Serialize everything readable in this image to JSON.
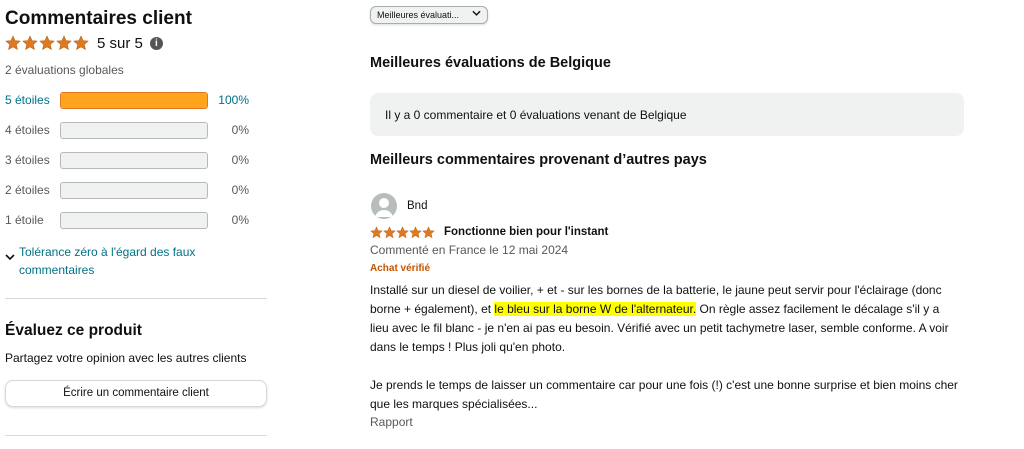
{
  "summary": {
    "title": "Commentaires client",
    "rating_value": 5,
    "rating_text": "5 sur 5",
    "global_count": "2 évaluations globales"
  },
  "histogram": [
    {
      "label": "5 étoiles",
      "percent": 100,
      "pct_text": "100%"
    },
    {
      "label": "4 étoiles",
      "percent": 0,
      "pct_text": "0%"
    },
    {
      "label": "3 étoiles",
      "percent": 0,
      "pct_text": "0%"
    },
    {
      "label": "2 étoiles",
      "percent": 0,
      "pct_text": "0%"
    },
    {
      "label": "1 étoile",
      "percent": 0,
      "pct_text": "0%"
    }
  ],
  "tolerance_link": "Tolérance zéro à l'égard des faux commentaires",
  "evaluate": {
    "title": "Évaluez ce produit",
    "subtitle": "Partagez votre opinion avec les autres clients",
    "button_label": "Écrire un commentaire client"
  },
  "sort": {
    "selected": "Meilleures évaluati..."
  },
  "belgium": {
    "heading": "Meilleures évaluations de Belgique",
    "message": "Il y a 0 commentaire et 0 évaluations venant de Belgique"
  },
  "other_countries_heading": "Meilleurs commentaires provenant d’autres pays",
  "review": {
    "reviewer": "Bnd",
    "rating": 5,
    "title": "Fonctionne bien pour l'instant",
    "date": "Commenté en France le 12 mai 2024",
    "verified": "Achat vérifié",
    "body_part1": "Installé sur un diesel de voilier, + et - sur les bornes de la batterie, le jaune peut servir pour l'éclairage (donc borne + également), et ",
    "body_highlight": "le bleu sur la borne W de l'alternateur.",
    "body_part2": " On règle assez facilement le décalage s'il y a lieu avec le fil blanc - je n'en ai pas eu besoin. Vérifié avec un petit tachymetre laser, semble conforme. A voir dans le temps ! Plus joli qu'en photo.",
    "body_para2": "Je prends le temps de laisser un commentaire car pour une fois (!) c'est une bonne surprise et bien moins cher que les marques spécialisées...",
    "report_label": "Rapport"
  },
  "colors": {
    "star": "#de7921",
    "bar_fill": "#ffa41c",
    "link": "#007185",
    "verified": "#c45500",
    "highlight": "#ffff00"
  },
  "icons": [
    "star-icon",
    "info-icon",
    "chevron-down-icon",
    "avatar-icon"
  ]
}
